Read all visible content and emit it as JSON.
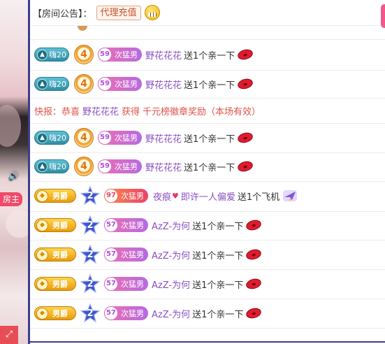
{
  "room_notice": {
    "label": "【房间公告】：",
    "tag": "代理充值",
    "emoji_icon": "grin-emoji-icon"
  },
  "stream": {
    "host_badge": "房主",
    "volume_icon": "speaker-icon",
    "expand_icon": "expand-icon"
  },
  "messages": [
    {
      "fan_badge": "嗨20",
      "level": "4",
      "rank_num": "59",
      "rank_title": "次猛男",
      "user": "野花花花",
      "action": "送1个亲一下",
      "gift": "lips-gift-icon"
    },
    {
      "fan_badge": "嗨20",
      "level": "4",
      "rank_num": "59",
      "rank_title": "次猛男",
      "user": "野花花花",
      "action": "送1个亲一下",
      "gift": "lips-gift-icon"
    },
    {
      "fan_badge": "嗨20",
      "level": "4",
      "rank_num": "59",
      "rank_title": "次猛男",
      "user": "野花花花",
      "action": "送1个亲一下",
      "gift": "lips-gift-icon"
    },
    {
      "fan_badge": "嗨20",
      "level": "4",
      "rank_num": "59",
      "rank_title": "次猛男",
      "user": "野花花花",
      "action": "送1个亲一下",
      "gift": "lips-gift-icon"
    },
    {
      "noble_badge": "男爵",
      "level": "2",
      "rank_num": "97",
      "rank_title": "次猛男",
      "user": "夜痕",
      "user_suffix": "即许一人偏爱",
      "action": "送1个飞机",
      "gift": "plane-gift-icon"
    },
    {
      "noble_badge": "男爵",
      "level": "2",
      "rank_num": "57",
      "rank_title": "次猛男",
      "user": "AzZ-为何",
      "action": "送1个亲一下",
      "gift": "lips-gift-icon"
    },
    {
      "noble_badge": "男爵",
      "level": "2",
      "rank_num": "57",
      "rank_title": "次猛男",
      "user": "AzZ-为何",
      "action": "送1个亲一下",
      "gift": "lips-gift-icon"
    },
    {
      "noble_badge": "男爵",
      "level": "2",
      "rank_num": "57",
      "rank_title": "次猛男",
      "user": "AzZ-为何",
      "action": "送1个亲一下",
      "gift": "lips-gift-icon"
    },
    {
      "noble_badge": "男爵",
      "level": "2",
      "rank_num": "57",
      "rank_title": "次猛男",
      "user": "AzZ-为何",
      "action": "送1个亲一下",
      "gift": "lips-gift-icon"
    }
  ],
  "flash_news": {
    "prefix": "快报：恭喜",
    "user": "野花花花",
    "middle": "获得",
    "reward": "千元榜徽章奖励（本场有效）"
  },
  "colors": {
    "panel_border": "#3b3d8f",
    "username": "#8a4fc4",
    "flash_text": "#e0534a",
    "host_badge": "#f04a6a"
  }
}
